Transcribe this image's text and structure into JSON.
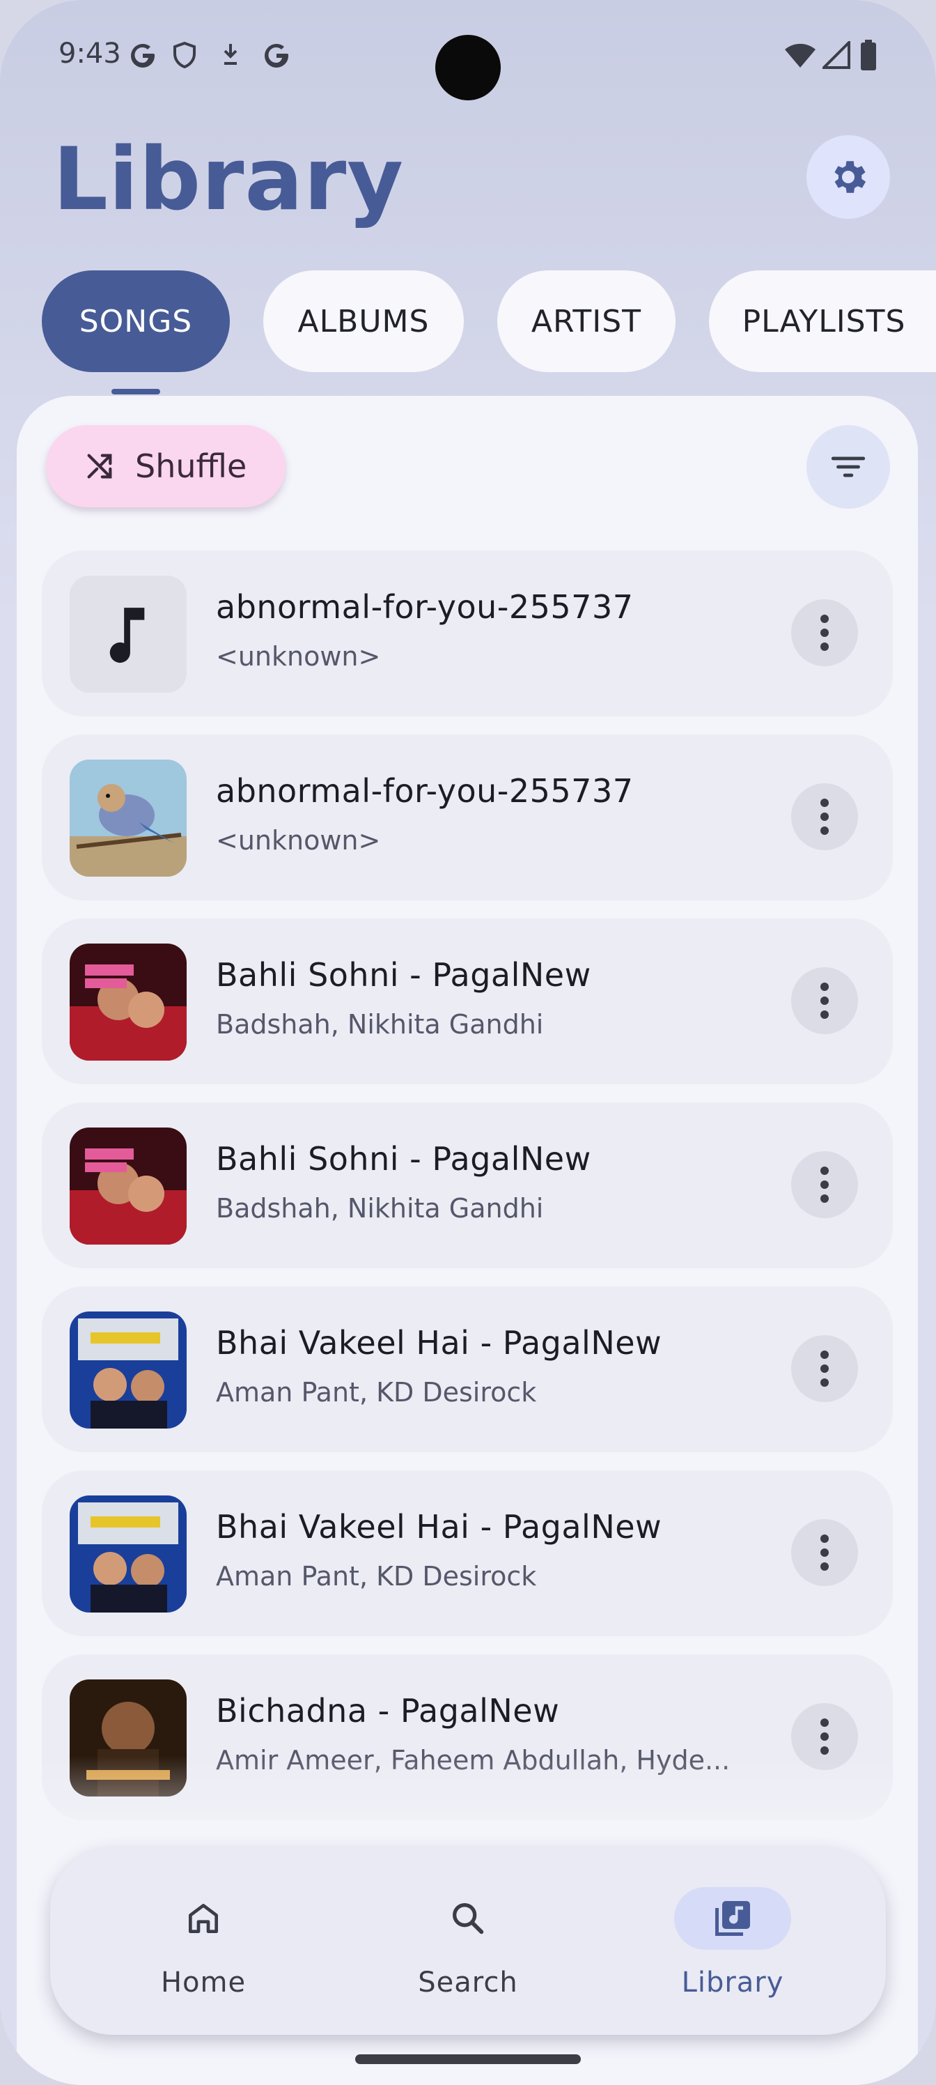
{
  "status": {
    "time": "9:43"
  },
  "header": {
    "title": "Library"
  },
  "tabs": [
    {
      "label": "SONGS",
      "active": true
    },
    {
      "label": "ALBUMS",
      "active": false
    },
    {
      "label": "ARTIST",
      "active": false
    },
    {
      "label": "PLAYLISTS",
      "active": false
    }
  ],
  "actions": {
    "shuffle_label": "Shuffle"
  },
  "songs": [
    {
      "title": "abnormal-for-you-255737",
      "artist": "<unknown>",
      "art": "music-note-placeholder"
    },
    {
      "title": "abnormal-for-you-255737",
      "artist": "<unknown>",
      "art": "bird-art"
    },
    {
      "title": "Bahli Sohni - PagalNew",
      "artist": "Badshah, Nikhita Gandhi",
      "art": "baaghi-art"
    },
    {
      "title": "Bahli Sohni - PagalNew",
      "artist": "Badshah, Nikhita Gandhi",
      "art": "baaghi-art"
    },
    {
      "title": "Bhai Vakeel Hai - PagalNew",
      "artist": "Aman Pant, KD Desirock",
      "art": "jolly-art"
    },
    {
      "title": "Bhai Vakeel Hai - PagalNew",
      "artist": "Aman Pant, KD Desirock",
      "art": "jolly-art"
    },
    {
      "title": "Bichadna - PagalNew",
      "artist": "Amir Ameer, Faheem Abdullah, Hyde...",
      "art": "bichadna-art"
    }
  ],
  "nav": [
    {
      "label": "Home",
      "icon": "home-icon",
      "active": false
    },
    {
      "label": "Search",
      "icon": "search-icon",
      "active": false
    },
    {
      "label": "Library",
      "icon": "library-icon",
      "active": true
    }
  ],
  "colors": {
    "primary": "#475b96",
    "shuffle_bg": "#fbd6ef",
    "background": "#f4f4fb"
  }
}
